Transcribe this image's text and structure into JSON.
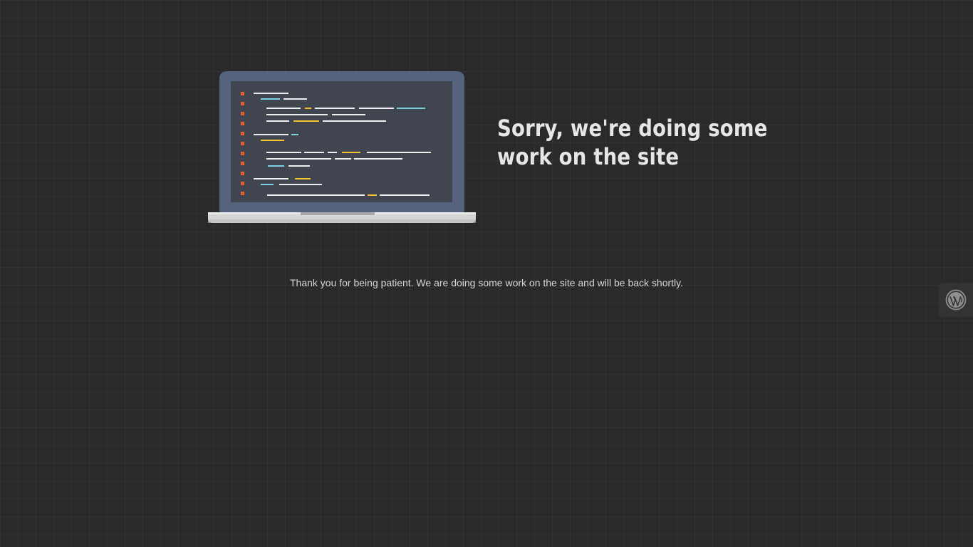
{
  "maintenance": {
    "headline": "Sorry, we're doing some work on the site",
    "message": "Thank you for being patient. We are doing some work on the site and will be back shortly."
  },
  "illustration": {
    "name": "laptop-code-illustration"
  },
  "admin_badge": {
    "icon": "wordpress-icon"
  },
  "colors": {
    "background": "#2a2a2a",
    "laptop_frame": "#55637e",
    "screen": "#414550",
    "base": "#d5d5d5",
    "accent_orange": "#e3622d",
    "accent_yellow": "#f0c330",
    "accent_blue": "#7ecfe3",
    "code_white": "#eeeeee"
  }
}
